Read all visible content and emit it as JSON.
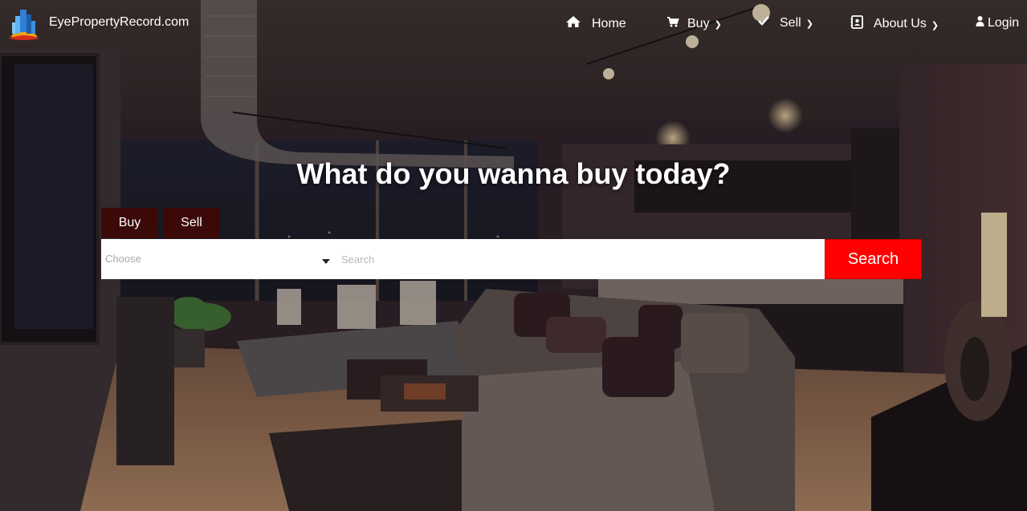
{
  "site": {
    "brand": "EyePropertyRecord.com"
  },
  "nav": {
    "items": [
      {
        "label": "Home",
        "icon": "home-icon"
      },
      {
        "label": "Buy",
        "icon": "cart-icon"
      },
      {
        "label": "Sell",
        "icon": "check-icon"
      },
      {
        "label": "About Us",
        "icon": "contact-card-icon"
      },
      {
        "label": "Login",
        "icon": "user-icon"
      }
    ]
  },
  "hero": {
    "headline": "What do you wanna buy today?",
    "tabs": [
      {
        "label": "Buy"
      },
      {
        "label": "Sell"
      }
    ],
    "select": {
      "value": "Choose"
    },
    "search": {
      "placeholder": "Search",
      "button_label": "Search"
    }
  },
  "colors": {
    "tab_bg": "#3b0a08",
    "search_button": "#ff0000",
    "text": "#ffffff"
  }
}
